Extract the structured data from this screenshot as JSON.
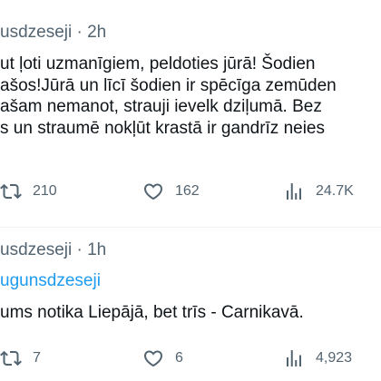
{
  "tweets": [
    {
      "handle": "usdzeseji",
      "separator": "·",
      "time": "2h",
      "mention": "",
      "lines": [
        "ut ļoti uzmanīgiem, peldoties jūrā! Šodien",
        "ašos!Jūrā un līcī šodien ir spēcīga zemūden",
        "ašam nemanot, strauji ievelk dziļumā. Bez",
        "s un straumē nokļūt krastā ir gandrīz neies"
      ],
      "retweets": "210",
      "likes": "162",
      "views": "24.7K"
    },
    {
      "handle": "usdzeseji",
      "separator": "·",
      "time": "1h",
      "mention": "ugunsdzeseji",
      "lines": [
        "ums notika Liepājā, bet trīs - Carnikavā."
      ],
      "retweets": "7",
      "likes": "6",
      "views": "4,923"
    }
  ],
  "icons": {
    "retweet": "retweet-icon",
    "like": "heart-icon",
    "views": "analytics-icon"
  },
  "colors": {
    "text": "#0f1419",
    "secondary": "#536471",
    "link": "#1d9bf0",
    "divider": "#eff3f4"
  }
}
